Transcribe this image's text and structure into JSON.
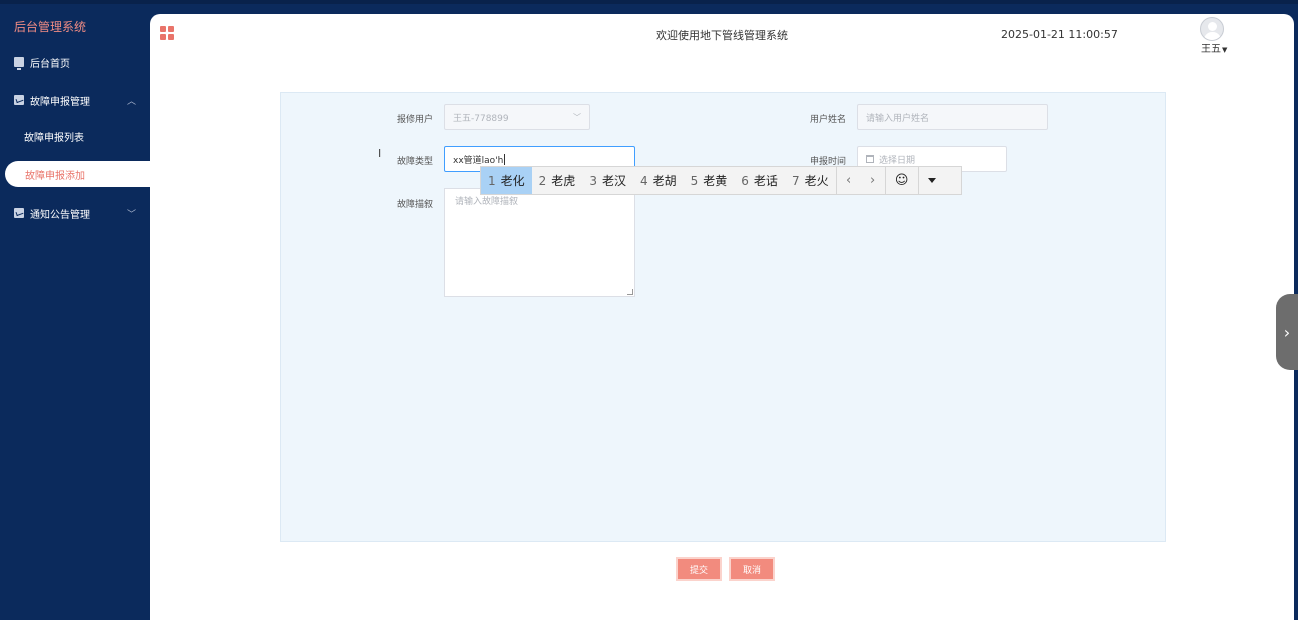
{
  "sidebar": {
    "brand": "后台管理系统",
    "items": [
      {
        "label": "后台首页"
      },
      {
        "label": "故障申报管理"
      },
      {
        "label": "故障申报列表"
      },
      {
        "label": "故障申报添加"
      },
      {
        "label": "通知公告管理"
      }
    ]
  },
  "header": {
    "welcome": "欢迎使用地下管线管理系统",
    "datetime": "2025-01-21 11:00:57",
    "user": "王五"
  },
  "form": {
    "reporter": {
      "label": "报修用户",
      "value": "王五-778899"
    },
    "username": {
      "label": "用户姓名",
      "placeholder": "请输入用户姓名"
    },
    "fault_type": {
      "label": "故障类型",
      "value": "xx管道lao'h"
    },
    "report_time": {
      "label": "申报时间",
      "placeholder": "选择日期"
    },
    "description": {
      "label": "故障描叙",
      "placeholder": "请输入故障描叙"
    }
  },
  "ime": {
    "candidates": [
      {
        "num": "1",
        "text": "老化"
      },
      {
        "num": "2",
        "text": "老虎"
      },
      {
        "num": "3",
        "text": "老汉"
      },
      {
        "num": "4",
        "text": "老胡"
      },
      {
        "num": "5",
        "text": "老黄"
      },
      {
        "num": "6",
        "text": "老话"
      },
      {
        "num": "7",
        "text": "老火"
      }
    ],
    "prev": "‹",
    "next": "›",
    "emoji": "☺"
  },
  "buttons": {
    "submit": "提交",
    "cancel": "取消"
  },
  "icons": {
    "side_handle": "chevron-right-icon",
    "brand_color": "#e9746a",
    "sidebar_bg": "#0b2a5c"
  }
}
